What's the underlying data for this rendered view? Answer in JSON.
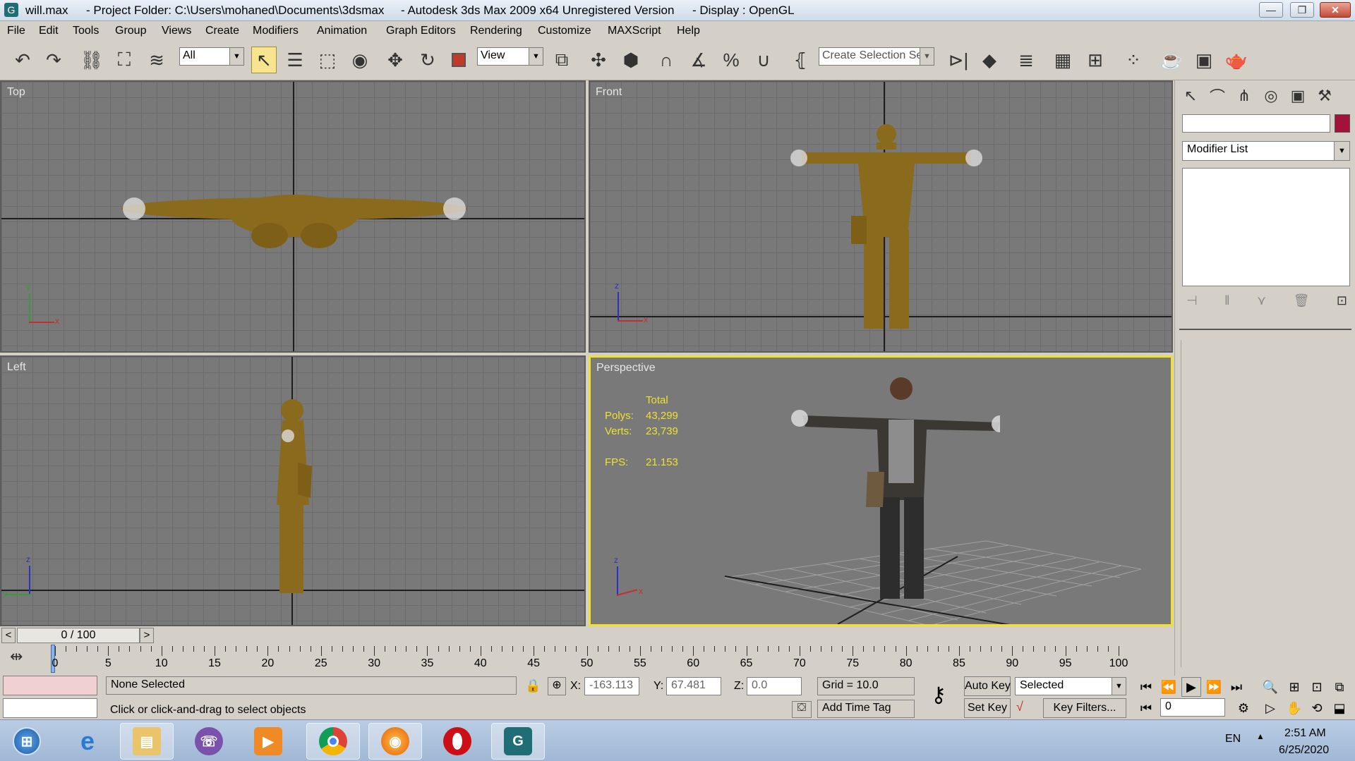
{
  "title": {
    "file": "will.max",
    "project": "- Project Folder: C:\\Users\\mohaned\\Documents\\3dsmax",
    "app": "- Autodesk 3ds Max  2009 x64   Unregistered Version",
    "display": "- Display : OpenGL",
    "minimize": "—",
    "restore": "❐",
    "close": "✕"
  },
  "menu": [
    "File",
    "Edit",
    "Tools",
    "Group",
    "Views",
    "Create",
    "Modifiers",
    "Animation",
    "Graph Editors",
    "Rendering",
    "Customize",
    "MAXScript",
    "Help"
  ],
  "toolbar": {
    "filter_value": "All",
    "refcoord_value": "View",
    "selection_set_placeholder": "Create Selection Set",
    "icons": [
      "undo-icon",
      "redo-icon",
      "select-and-link-icon",
      "unlink-icon",
      "bind-space-warp-icon",
      "select-object-icon",
      "select-by-name-icon",
      "rect-region-icon",
      "window-crossing-icon",
      "move-icon",
      "rotate-icon",
      "scale-icon",
      "pivot-icon",
      "manipulate-icon",
      "keyboard-shortcut-icon",
      "snaps-icon",
      "angle-snap-icon",
      "percent-snap-icon",
      "spinner-snap-icon",
      "edit-named-sets-icon",
      "mirror-icon",
      "align-icon",
      "layer-manager-icon",
      "curve-editor-icon",
      "schematic-view-icon",
      "material-editor-icon",
      "render-setup-icon",
      "rendered-frame-icon",
      "quick-render-icon"
    ]
  },
  "viewports": {
    "top": {
      "label": "Top"
    },
    "front": {
      "label": "Front"
    },
    "left": {
      "label": "Left"
    },
    "perspective": {
      "label": "Perspective",
      "stats": {
        "total_label": "Total",
        "polys_label": "Polys:",
        "polys_value": "43,299",
        "verts_label": "Verts:",
        "verts_value": "23,739",
        "fps_label": "FPS:",
        "fps_value": "21.153"
      }
    },
    "axis_x": "x",
    "axis_y": "y",
    "axis_z": "z"
  },
  "command_panel": {
    "name_value": "",
    "color_swatch": "#a3123a",
    "modifier_list": "Modifier List"
  },
  "timeline": {
    "slider_value": "0 / 100",
    "prev": "<",
    "next": ">",
    "labels": [
      "0",
      "5",
      "10",
      "15",
      "20",
      "25",
      "30",
      "35",
      "40",
      "45",
      "50",
      "55",
      "60",
      "65",
      "70",
      "75",
      "80",
      "85",
      "90",
      "95",
      "100"
    ]
  },
  "status": {
    "selection": "None Selected",
    "prompt": "Click or click-and-drag to select objects",
    "x_label": "X:",
    "x_value": "-163.113",
    "y_label": "Y:",
    "y_value": "67.481",
    "z_label": "Z:",
    "z_value": "0.0",
    "grid": "Grid = 10.0",
    "add_time_tag": "Add Time Tag",
    "auto_key": "Auto Key",
    "set_key": "Set Key",
    "key_mode_value": "Selected",
    "key_filters": "Key Filters...",
    "frame_value": "0"
  },
  "taskbar": {
    "apps": [
      "start-orb-icon",
      "internet-explorer-icon",
      "file-explorer-icon",
      "viber-icon",
      "media-player-icon",
      "chrome-icon",
      "firefox-icon",
      "opera-icon",
      "3dsmax-icon"
    ],
    "lang": "EN",
    "time": "2:51 AM",
    "date": "6/25/2020"
  },
  "colors": {
    "active_viewport_border": "#f0e030",
    "mesh_wire": "#8a6a1c",
    "viewport_bg": "#797979"
  }
}
